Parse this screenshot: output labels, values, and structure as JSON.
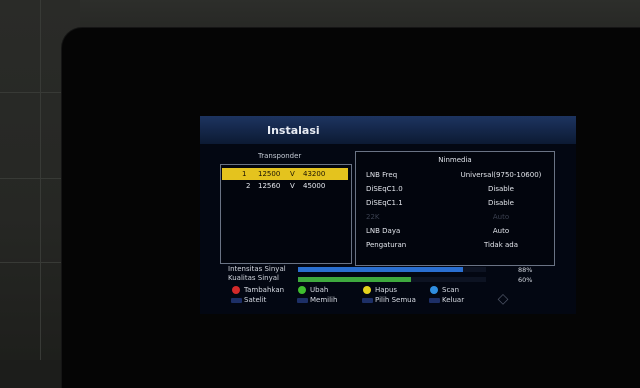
{
  "window": {
    "title": "Instalasi"
  },
  "transponder": {
    "header": "Transponder",
    "rows": [
      {
        "index": "1",
        "freq": "12500",
        "pol": "V",
        "sr": "43200",
        "selected": true
      },
      {
        "index": "2",
        "freq": "12560",
        "pol": "V",
        "sr": "45000",
        "selected": false
      }
    ]
  },
  "satellite": {
    "name": "Ninmedia",
    "settings": [
      {
        "label": "LNB Freq",
        "value": "Universal(9750-10600)",
        "enabled": true
      },
      {
        "label": "DiSEqC1.0",
        "value": "Disable",
        "enabled": true
      },
      {
        "label": "DiSEqC1.1",
        "value": "Disable",
        "enabled": true
      },
      {
        "label": "22K",
        "value": "Auto",
        "enabled": false
      },
      {
        "label": "LNB Daya",
        "value": "Auto",
        "enabled": true
      },
      {
        "label": "Pengaturan",
        "value": "Tidak ada",
        "enabled": true
      }
    ]
  },
  "signal": {
    "intensity_label": "Intensitas Sinyal",
    "quality_label": "Kualitas Sinyal",
    "intensity_percent": 88,
    "quality_percent": 60,
    "intensity_text": "88%",
    "quality_text": "60%",
    "intensity_color": "#2a6fd0",
    "quality_color": "#3ea93e"
  },
  "keys": {
    "red": "Tambahkan",
    "green": "Ubah",
    "yellow": "Hapus",
    "blue": "Scan",
    "sat": "Satelit",
    "ok": "Memilih",
    "page": "Pilih Semua",
    "exit": "Keluar"
  },
  "colors": {
    "red": "#d42a2a",
    "green": "#3fbe2f",
    "yellow": "#e4d21c",
    "blue": "#2f8ee0",
    "highlight": "#e4c31e"
  }
}
